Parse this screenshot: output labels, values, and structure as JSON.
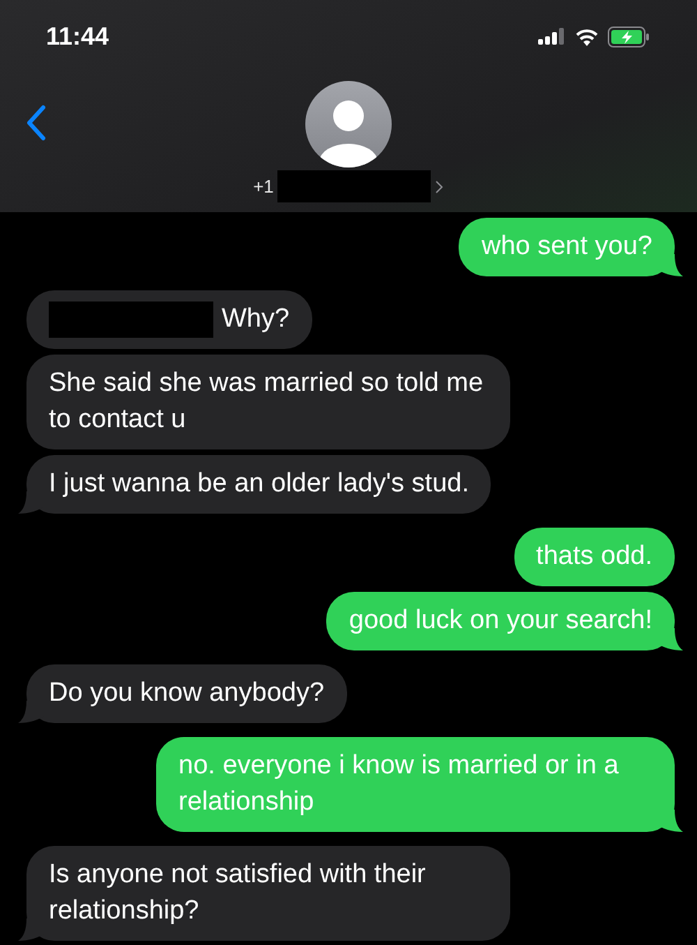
{
  "status_bar": {
    "time": "11:44"
  },
  "contact": {
    "number_prefix": "+1",
    "number_redacted": true
  },
  "messages": [
    {
      "kind": "sent",
      "text": "who sent you?"
    },
    {
      "kind": "received",
      "text": "Why?",
      "redacted_prefix": true
    },
    {
      "kind": "received",
      "text": "She said she was married so told me to contact u"
    },
    {
      "kind": "received",
      "text": "I just wanna be an older lady's stud."
    },
    {
      "kind": "sent",
      "text": "thats odd."
    },
    {
      "kind": "sent",
      "text": "good luck on your search!"
    },
    {
      "kind": "received",
      "text": "Do you know anybody?"
    },
    {
      "kind": "sent",
      "text": "no. everyone i know is married or in a relationship"
    },
    {
      "kind": "received",
      "text": "Is anyone not satisfied with their relationship?"
    }
  ]
}
